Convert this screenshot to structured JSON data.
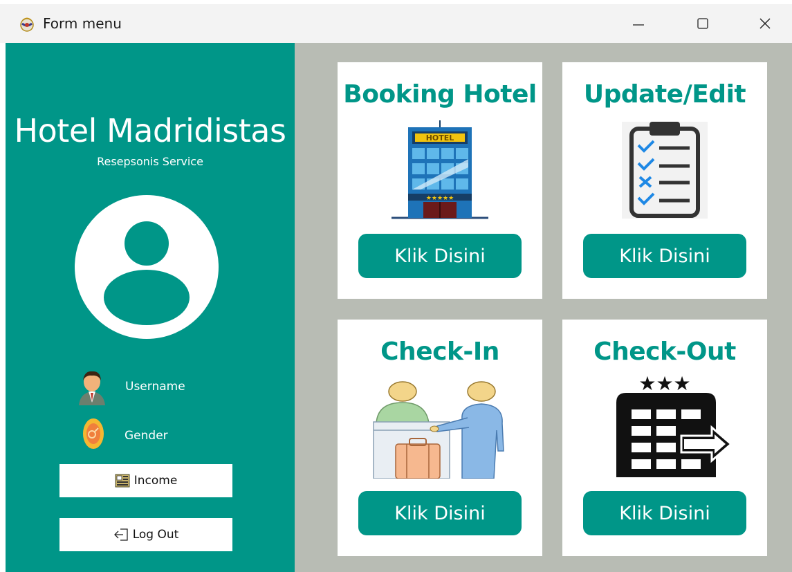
{
  "window": {
    "title": "Form menu",
    "app_icon": "real-madrid-crest-icon",
    "controls": [
      "minimize-icon",
      "maximize-icon",
      "close-icon"
    ]
  },
  "sidebar": {
    "title": "Hotel Madridistas",
    "subtitle": "Resepsonis Service",
    "avatar_icon": "user-avatar-icon",
    "username_label": "Username",
    "gender_label": "Gender",
    "income_label": "Income",
    "logout_label": "Log Out"
  },
  "menu": {
    "cards": [
      {
        "title": "Booking Hotel",
        "icon": "hotel-building-icon",
        "button": "Klik Disini"
      },
      {
        "title": "Update/Edit",
        "icon": "checklist-clipboard-icon",
        "button": "Klik Disini"
      },
      {
        "title": "Check-In",
        "icon": "reception-checkin-icon",
        "button": "Klik Disini"
      },
      {
        "title": "Check-Out",
        "icon": "hotel-checkout-icon",
        "button": "Klik Disini"
      }
    ]
  },
  "colors": {
    "accent": "#009688",
    "main_bg": "#b8bcb4",
    "titlebar_bg": "#f3f3f3"
  }
}
